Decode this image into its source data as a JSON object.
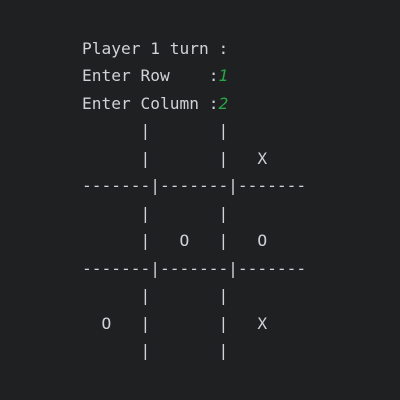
{
  "console": {
    "prompt_turn": "Player 1 turn :",
    "prompt_row": "Enter Row    :",
    "row_value": "1",
    "prompt_column": "Enter Column :",
    "column_value": "2",
    "board_lines": [
      "      |       |",
      "      |       |   X",
      "-------|-------|-------",
      "      |       |",
      "      |   O   |   O",
      "-------|-------|-------",
      "      |       |",
      "  O   |       |   X",
      "      |       |"
    ]
  },
  "colors": {
    "background": "#1f2022",
    "text": "#cfd2d6",
    "input": "#27a745"
  }
}
